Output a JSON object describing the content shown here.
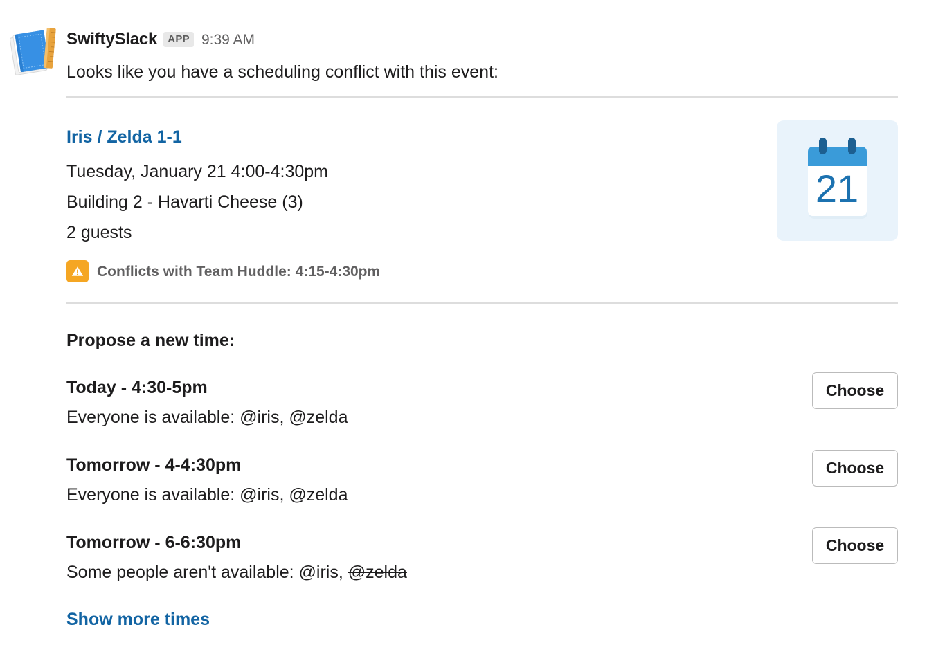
{
  "message": {
    "sender": "SwiftySlack",
    "app_badge": "APP",
    "timestamp": "9:39 AM",
    "avatar_icon": "notebook-ruler-icon",
    "intro_text": "Looks like you have a scheduling conflict with this event:"
  },
  "event": {
    "title": "Iris / Zelda 1-1",
    "date_time": "Tuesday, January 21 4:00-4:30pm",
    "location": "Building 2 - Havarti Cheese (3)",
    "guests": "2 guests",
    "conflict_icon": "warning-icon",
    "conflict_text": "Conflicts with Team Huddle: 4:15-4:30pm",
    "calendar_icon": "calendar-icon",
    "calendar_day": "21"
  },
  "propose": {
    "heading": "Propose a new time:",
    "slots": [
      {
        "title": "Today - 4:30-5pm",
        "availability": "Everyone is available: @iris, @zelda",
        "availability_prefix": "Everyone is available: @iris, @zelda",
        "unavailable_user": "",
        "button_label": "Choose"
      },
      {
        "title": "Tomorrow - 4-4:30pm",
        "availability": "Everyone is available: @iris, @zelda",
        "availability_prefix": "Everyone is available: @iris, @zelda",
        "unavailable_user": "",
        "button_label": "Choose"
      },
      {
        "title": "Tomorrow - 6-6:30pm",
        "availability": "Some people aren't available: @iris, @zelda",
        "availability_prefix": "Some people aren't available: @iris, ",
        "unavailable_user": "@zelda",
        "button_label": "Choose"
      }
    ],
    "show_more_label": "Show more times"
  },
  "colors": {
    "link": "#1264a3",
    "text": "#1d1c1d",
    "muted": "#616061",
    "warning": "#f5a623",
    "divider": "#dddddd",
    "calendar_bg": "#e9f3fb",
    "calendar_header": "#3a9bd9",
    "calendar_number": "#1264a3",
    "badge_bg": "#e8e8e8"
  }
}
